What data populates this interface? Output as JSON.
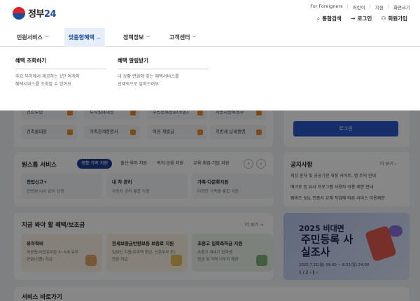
{
  "brand": {
    "name_prefix": "정부",
    "name_suffix": "24"
  },
  "utility": {
    "foreigners": "For Foreigners",
    "links": [
      "어린이",
      "지원",
      "화면크기"
    ]
  },
  "actions": [
    {
      "icon": "search-icon",
      "label": "통합검색"
    },
    {
      "icon": "login-icon",
      "label": "로그인"
    },
    {
      "icon": "signup-icon",
      "label": "회원가입"
    }
  ],
  "gnb": [
    {
      "label": "민원서비스",
      "active": false
    },
    {
      "label": "맞춤형혜택",
      "active": true
    },
    {
      "label": "정책정보",
      "active": false
    },
    {
      "label": "고객센터",
      "active": false
    }
  ],
  "dropdown": {
    "col1": {
      "title": "혜택 조회하기",
      "desc1": "주요 부처에서 제공하는 1만 여개의",
      "desc2": "혜택서비스를 조회할 수 있어요"
    },
    "col2": {
      "title": "혜택 알림받기",
      "desc1": "내 상황 변화에 맞는 혜택서비스를",
      "desc2": "선제적으로 알려드려요"
    }
  },
  "quick_tiles": [
    "건강보험",
    "토지임야대장",
    "주민등록등본(초본)",
    "자동차등록원부",
    "건축물대장",
    "가족관계증명서",
    "여권 재발급",
    "지방세 납세증명"
  ],
  "login_label": "로그인",
  "one_stop": {
    "title": "원스톱 서비스",
    "chips": [
      "생활·가족 지원",
      "출산·육아 지원",
      "복지·금융 지원",
      "교육·취업·기업 지원"
    ],
    "services": [
      {
        "name": "전입신고+",
        "desc": "한번에 이사 같이 신청"
      },
      {
        "name": "내 차 관리",
        "desc": "자동차 관리 통합 지원"
      },
      {
        "name": "가족·다문화지원",
        "desc": "다양한 가족을 통합 지원"
      }
    ]
  },
  "notice": {
    "title": "공지사항",
    "more": "더 보기",
    "items": [
      "피싱 문자 및 공공기관 위장 사이트, 앱 주의 안내",
      "매크로 등 유사 프로그램 사용자 이용 제한 안내",
      "웨비즈 SSL 인증서 교체 작업에 따른 서비스 이용제한"
    ]
  },
  "benefits": {
    "title": "지금 봐야 할 혜택/보조금",
    "more": "더 보기",
    "cards": [
      {
        "name": "유아학비",
        "desc1": "국공립/사립유치원 3~5세 유아",
        "desc2": "현금(상품) 지급"
      },
      {
        "name": "전세보증금반환보증 보증료 지원",
        "desc1": "임차인 지원(무주택 청년, 신혼부부 등)",
        "desc2": "현금 지급"
      },
      {
        "name": "초중고 입학축하금 지원",
        "desc1": "초중고 새내기 입학생",
        "desc2": "현금 및 지역 나우지 제공"
      }
    ]
  },
  "banner": {
    "year": "2025 비대면",
    "headline": "주민등록 사실조사",
    "period": "2025.7.21(월) 09:00 ~ 8.31(일) 24:00",
    "pager": "1 / 2"
  },
  "bottom": {
    "title": "서비스 바로가기"
  }
}
